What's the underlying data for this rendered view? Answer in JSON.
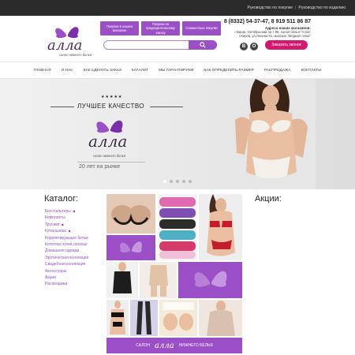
{
  "topbar": {
    "links": [
      "Руководство по покупке",
      "Руководство по изделию"
    ]
  },
  "header": {
    "logo_text": "алла",
    "logo_subtitle": "салон нижнего белья",
    "promo_buttons": [
      "Покупки в нашем магазине",
      "Покупки по предварительному заказу",
      "Совместные покупки"
    ],
    "search_placeholder": "",
    "phones": "8 (8332) 54-37-47, 8 919 511 86 87",
    "address_title": "Адреса наших магазинов:",
    "address_lines": [
      "г.Киров, Октябрьский пр-т 86, салон белья \"Алла\"",
      "г.Киров, ул.Ленина 61, магазин \"Модная точка\""
    ],
    "social": [
      "В",
      "O"
    ],
    "callback_label": "Заказать звонок"
  },
  "nav": {
    "items": [
      "Главная",
      "О нас",
      "Как сделать заказ",
      "Каталог",
      "Мы гарантируем",
      "Как определить размер",
      "Распродажа",
      "Контакты"
    ]
  },
  "banner": {
    "stars": "★★★★★",
    "headline": "ЛУЧШЕЕ КАЧЕСТВО",
    "logo_text": "алла",
    "logo_subtitle": "салон нижнего белья",
    "years": "20 лет на рынке",
    "slide_count": 5,
    "active_slide": 1
  },
  "catalog": {
    "title": "Каталог:",
    "items": [
      {
        "label": "Бюстгальтеры",
        "has_sub": true
      },
      {
        "label": "Комплекты",
        "has_sub": false
      },
      {
        "label": "Трусики",
        "has_sub": true
      },
      {
        "label": "Купальники",
        "has_sub": true
      },
      {
        "label": "Корректирующее белье",
        "has_sub": false
      },
      {
        "label": "Колготки,чулки,лосины",
        "has_sub": false
      },
      {
        "label": "Домашняя одежда",
        "has_sub": false
      },
      {
        "label": "Эротическая коллекция",
        "has_sub": false
      },
      {
        "label": "Свадебная коллекция",
        "has_sub": false
      },
      {
        "label": "Аксессуары",
        "has_sub": false
      },
      {
        "label": "Акции",
        "has_sub": false
      },
      {
        "label": "Распродажа",
        "has_sub": false
      }
    ]
  },
  "actions": {
    "title": "Акции:"
  },
  "tiles_banner": {
    "text_left": "САЛОН",
    "logo_text": "алла",
    "text_right": "НИЖНЕГО БЕЛЬЯ"
  },
  "colors": {
    "accent": "#9b4fc7",
    "callback": "#d3186f",
    "topbar": "#2b2b2b"
  }
}
